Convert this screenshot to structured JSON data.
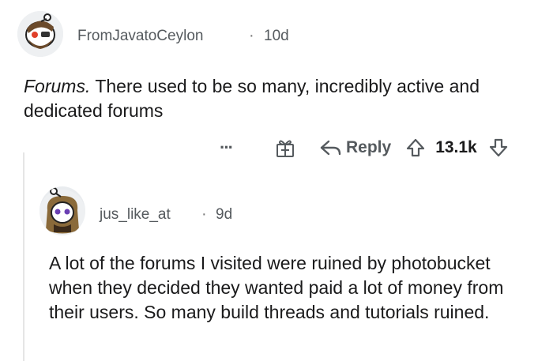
{
  "comment": {
    "author": "FromJavatoCeylon",
    "separator": "·",
    "time": "10d",
    "body_lead": "Forums.",
    "body_rest": " There used to be so many, incredibly active and dedicated forums",
    "actions": {
      "more_label": "···",
      "reply_label": "Reply",
      "score": "13.1k"
    }
  },
  "reply": {
    "author": "jus_like_at",
    "separator": "·",
    "time": "9d",
    "body": "A lot of the forums I visited were ruined by photobucket when they decided they wanted paid a lot of money from their users. So many build threads and tutorials ruined."
  },
  "colors": {
    "text": "#1a1a1b",
    "meta": "#555a5e",
    "avatar_bg": "#e9ecef",
    "thread_line": "#e5e5e5"
  }
}
